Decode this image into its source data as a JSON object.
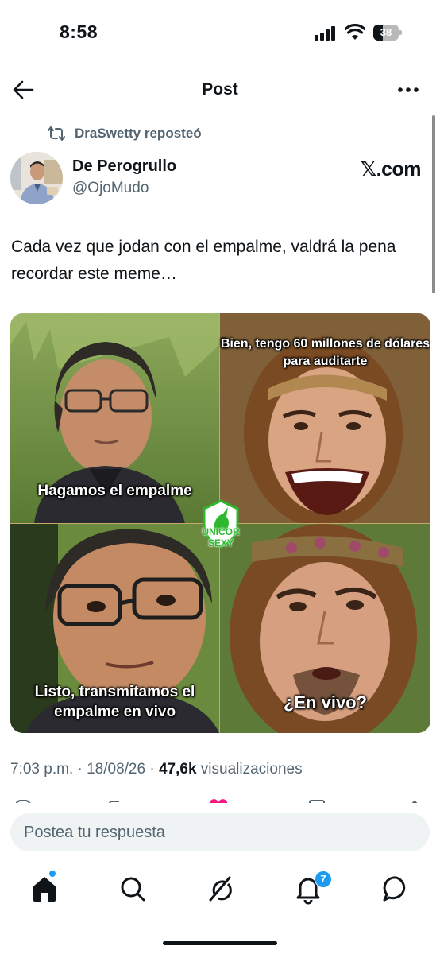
{
  "status_bar": {
    "time": "8:58",
    "battery": "38",
    "battery_level_percent": 38
  },
  "header": {
    "title": "Post"
  },
  "repost": {
    "text": "DraSwetty reposteó"
  },
  "author": {
    "name": "De Perogrullo",
    "handle": "@OjoMudo",
    "source": "𝕏.com"
  },
  "post": {
    "text": "Cada vez que jodan con el empalme, valdrá la pena recordar este meme…",
    "meme": {
      "caption_top_left": "Hagamos el empalme",
      "caption_top_right": "Bien, tengo 60 millones de dólares para auditarte",
      "caption_bottom_left": "Listo, transmitamos el empalme en vivo",
      "caption_bottom_right": "¿En vivo?",
      "watermark": "UNICOR SEXY"
    }
  },
  "meta": {
    "time": "7:03 p.m.",
    "separator": "·",
    "date": "18/08/26",
    "views_count": "47,6k",
    "views_label": "visualizaciones"
  },
  "reply": {
    "placeholder": "Postea tu respuesta"
  },
  "nav": {
    "notifications_badge": "7",
    "accent": "#1d9bf0"
  },
  "colors": {
    "text": "#0f1419",
    "secondary": "#536471",
    "input_bg": "#eff3f4"
  }
}
